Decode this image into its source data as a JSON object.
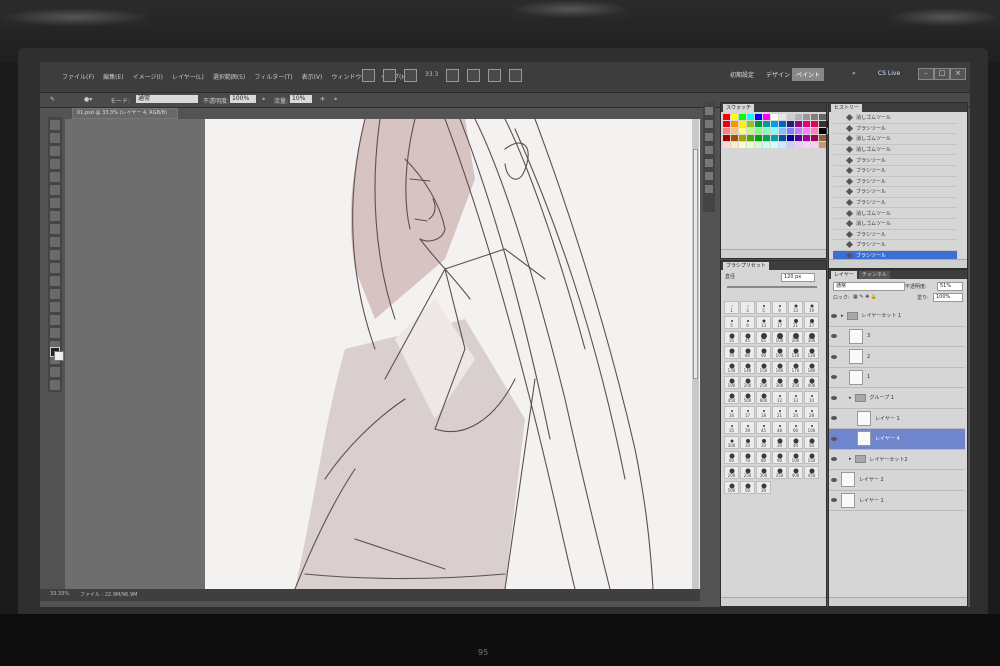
{
  "menu": {
    "items": [
      "ファイル(F)",
      "編集(E)",
      "イメージ(I)",
      "レイヤー(L)",
      "選択範囲(S)",
      "フィルター(T)",
      "表示(V)",
      "ウィンドウ(W)",
      "ヘルプ(H)"
    ],
    "zoom": "33.3"
  },
  "workspace": {
    "items": [
      "初期設定",
      "デザイン",
      "ペイント"
    ],
    "active": "ペイント",
    "more": "»",
    "cs_live": "CS Live"
  },
  "window_controls": [
    "–",
    "□",
    "×"
  ],
  "options": {
    "mode_label": "モード:",
    "mode_value": "通常",
    "opacity_label": "不透明度:",
    "opacity_value": "100%",
    "flow_label": "流量:",
    "flow_value": "10%"
  },
  "document": {
    "tab_title": "01.psd @ 33.3% (レイヤー 4, RGB/8)"
  },
  "status": {
    "zoom": "33.33%",
    "file_info": "ファイル : 22.9M/96.9M"
  },
  "swatches": {
    "tab_label": "スウォッチ",
    "colors": [
      "#ff0000",
      "#ffff00",
      "#00ff00",
      "#00ffff",
      "#0000ff",
      "#ff00ff",
      "#ffffff",
      "#e6e6e6",
      "#cccccc",
      "#b3b3b3",
      "#999999",
      "#808080",
      "#666666",
      "#4d4d4d",
      "#e60012",
      "#f39800",
      "#fff100",
      "#8fc31f",
      "#009944",
      "#009e96",
      "#00a0e9",
      "#0068b7",
      "#1d2088",
      "#920783",
      "#e4007f",
      "#e5004f",
      "#333333",
      "#1a1a1a",
      "#ff7f7f",
      "#ffbf7f",
      "#ffff7f",
      "#bfff7f",
      "#7fff7f",
      "#7fffbf",
      "#7fffff",
      "#7fbfff",
      "#7f7fff",
      "#bf7fff",
      "#ff7fff",
      "#ff7fbf",
      "#000000",
      "#c8a882",
      "#a40000",
      "#a45200",
      "#a4a400",
      "#52a400",
      "#00a400",
      "#00a452",
      "#00a4a4",
      "#0052a4",
      "#0000a4",
      "#5200a4",
      "#a400a4",
      "#a40052",
      "#8c6239",
      "#603813",
      "#ffd5d5",
      "#ffe8cc",
      "#fffacc",
      "#e8ffcc",
      "#ccffcc",
      "#ccffe8",
      "#ccffff",
      "#cce8ff",
      "#ccccff",
      "#e8ccff",
      "#ffccff",
      "#ffcce8",
      "#c69c6d",
      "#754c24"
    ]
  },
  "history": {
    "tab_label": "ヒストリー",
    "items": [
      "消しゴムツール",
      "ブラシツール",
      "消しゴムツール",
      "消しゴムツール",
      "ブラシツール",
      "ブラシツール",
      "ブラシツール",
      "ブラシツール",
      "ブラシツール",
      "消しゴムツール",
      "消しゴムツール",
      "ブラシツール",
      "ブラシツール",
      "ブラシツール"
    ],
    "selected_index": 13
  },
  "brush_presets": {
    "tab_label": "ブラシプリセット",
    "size_label": "直径",
    "size_value": "120 px",
    "cells": [
      {
        "n": "1",
        "s": 1
      },
      {
        "n": "3",
        "s": 1
      },
      {
        "n": "5",
        "s": 2
      },
      {
        "n": "9",
        "s": 2
      },
      {
        "n": "13",
        "s": 3
      },
      {
        "n": "19",
        "s": 3
      },
      {
        "n": "5",
        "s": 2
      },
      {
        "n": "9",
        "s": 2
      },
      {
        "n": "13",
        "s": 3
      },
      {
        "n": "17",
        "s": 3
      },
      {
        "n": "21",
        "s": 4
      },
      {
        "n": "27",
        "s": 4
      },
      {
        "n": "35",
        "s": 5
      },
      {
        "n": "45",
        "s": 5
      },
      {
        "n": "65",
        "s": 6
      },
      {
        "n": "100",
        "s": 6
      },
      {
        "n": "200",
        "s": 6
      },
      {
        "n": "300",
        "s": 6
      },
      {
        "n": "70",
        "s": 5
      },
      {
        "n": "80",
        "s": 5
      },
      {
        "n": "90",
        "s": 5
      },
      {
        "n": "100",
        "s": 5
      },
      {
        "n": "110",
        "s": 5
      },
      {
        "n": "120",
        "s": 5
      },
      {
        "n": "130",
        "s": 5
      },
      {
        "n": "140",
        "s": 5
      },
      {
        "n": "150",
        "s": 5
      },
      {
        "n": "160",
        "s": 5
      },
      {
        "n": "170",
        "s": 5
      },
      {
        "n": "180",
        "s": 5
      },
      {
        "n": "190",
        "s": 5
      },
      {
        "n": "200",
        "s": 5
      },
      {
        "n": "250",
        "s": 5
      },
      {
        "n": "300",
        "s": 5
      },
      {
        "n": "350",
        "s": 5
      },
      {
        "n": "400",
        "s": 5
      },
      {
        "n": "450",
        "s": 5
      },
      {
        "n": "500",
        "s": 5
      },
      {
        "n": "600",
        "s": 5
      },
      {
        "n": "12",
        "s": 2
      },
      {
        "n": "13",
        "s": 2
      },
      {
        "n": "14",
        "s": 2
      },
      {
        "n": "16",
        "s": 2
      },
      {
        "n": "17",
        "s": 2
      },
      {
        "n": "18",
        "s": 2
      },
      {
        "n": "21",
        "s": 2
      },
      {
        "n": "24",
        "s": 2
      },
      {
        "n": "28",
        "s": 2
      },
      {
        "n": "35",
        "s": 2
      },
      {
        "n": "39",
        "s": 2
      },
      {
        "n": "45",
        "s": 2
      },
      {
        "n": "48",
        "s": 2
      },
      {
        "n": "60",
        "s": 2
      },
      {
        "n": "100",
        "s": 2
      },
      {
        "n": "300",
        "s": 3
      },
      {
        "n": "10",
        "s": 4
      },
      {
        "n": "20",
        "s": 4
      },
      {
        "n": "30",
        "s": 5
      },
      {
        "n": "40",
        "s": 5
      },
      {
        "n": "50",
        "s": 5
      },
      {
        "n": "60",
        "s": 5
      },
      {
        "n": "70",
        "s": 5
      },
      {
        "n": "80",
        "s": 5
      },
      {
        "n": "90",
        "s": 5
      },
      {
        "n": "100",
        "s": 5
      },
      {
        "n": "150",
        "s": 5
      },
      {
        "n": "200",
        "s": 5
      },
      {
        "n": "250",
        "s": 5
      },
      {
        "n": "300",
        "s": 5
      },
      {
        "n": "350",
        "s": 5
      },
      {
        "n": "400",
        "s": 5
      },
      {
        "n": "450",
        "s": 5
      },
      {
        "n": "500",
        "s": 5
      },
      {
        "n": "50",
        "s": 5
      },
      {
        "n": "30",
        "s": 5
      }
    ]
  },
  "layers": {
    "tab_label": "レイヤー",
    "tab2_label": "チャンネル",
    "blend_mode": "通常",
    "opacity_label": "不透明度:",
    "opacity_value": "51%",
    "lock_label": "ロック:",
    "fill_label": "塗り:",
    "fill_value": "100%",
    "items": [
      {
        "name": "レイヤーセット 1",
        "type": "group",
        "indent": 0
      },
      {
        "name": "3",
        "type": "layer",
        "indent": 1
      },
      {
        "name": "2",
        "type": "layer",
        "indent": 1
      },
      {
        "name": "1",
        "type": "layer",
        "indent": 1
      },
      {
        "name": "グループ 1",
        "type": "group",
        "indent": 1
      },
      {
        "name": "レイヤー 1",
        "type": "layer",
        "indent": 2
      },
      {
        "name": "レイヤー 4",
        "type": "layer",
        "indent": 2,
        "selected": true
      },
      {
        "name": "レイヤーセット2",
        "type": "group",
        "indent": 1
      },
      {
        "name": "レイヤー 2",
        "type": "layer",
        "indent": 0
      },
      {
        "name": "レイヤー 1",
        "type": "layer",
        "indent": 0
      }
    ]
  }
}
